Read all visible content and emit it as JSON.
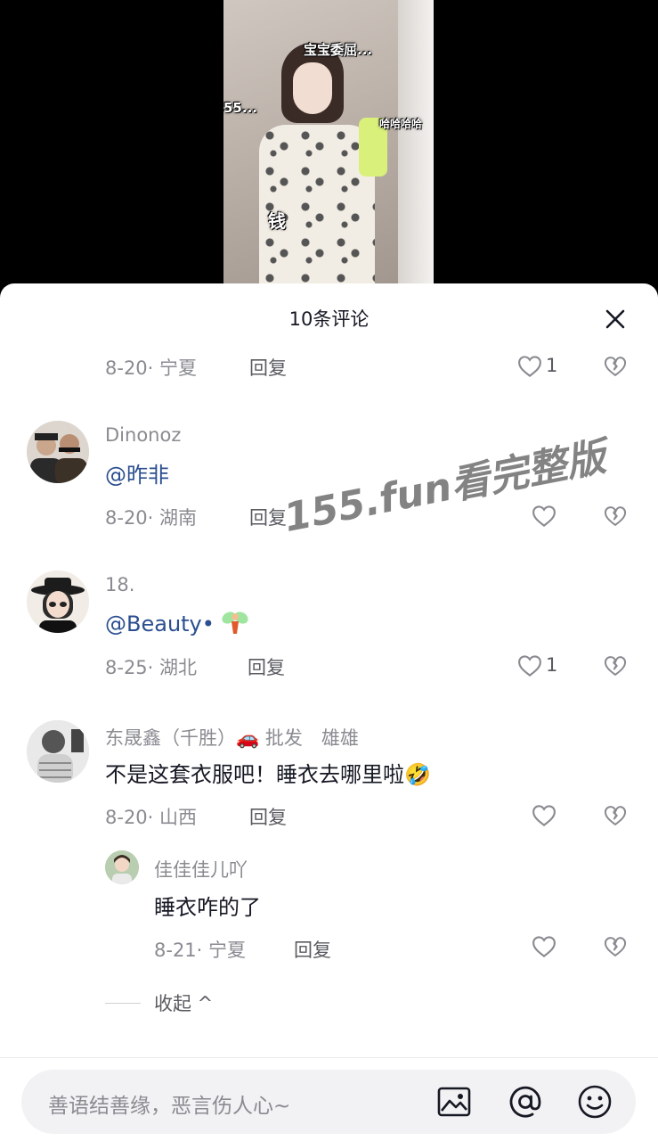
{
  "video": {
    "captions": [
      "宝宝委屈...",
      "55...",
      "钱",
      "哈哈哈哈"
    ]
  },
  "sheet": {
    "title": "10条评论"
  },
  "comments": [
    {
      "time_location": "8-20· 宁夏",
      "reply_label": "回复",
      "like_count": "1"
    },
    {
      "username": "Dinonoz",
      "text": "@昨非",
      "time_location": "8-20· 湖南",
      "reply_label": "回复",
      "like_count": ""
    },
    {
      "username": "18.",
      "text": "@Beauty•",
      "time_location": "8-25· 湖北",
      "reply_label": "回复",
      "like_count": "1"
    },
    {
      "username": "东晟鑫（千胜）🚗 批发　雄雄",
      "text": "不是这套衣服吧！睡衣去哪里啦🤣",
      "time_location": "8-20· 山西",
      "reply_label": "回复",
      "like_count": ""
    }
  ],
  "sub_reply": {
    "username": "佳佳佳儿吖",
    "text": "睡衣咋的了",
    "time_location": "8-21· 宁夏",
    "reply_label": "回复"
  },
  "collapse_label": "收起 ^",
  "watermark": "155.fun看完整版",
  "input": {
    "placeholder": "善语结善缘，恶言伤人心~"
  },
  "icons": {
    "close": "close-icon",
    "like": "heart-outline-icon",
    "dislike": "broken-heart-icon",
    "image": "image-icon",
    "mention": "at-icon",
    "emoji": "smiley-icon"
  }
}
